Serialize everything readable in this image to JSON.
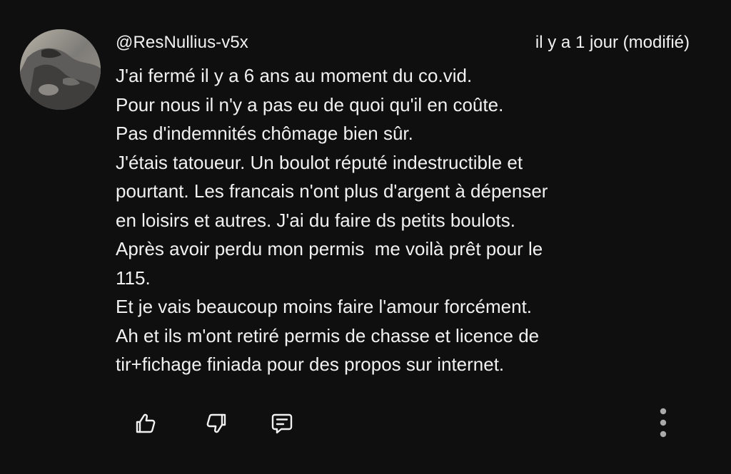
{
  "comment": {
    "author": "@ResNullius-v5x",
    "timestamp": "il y a 1 jour (modifié)",
    "lines": [
      "J'ai fermé il y a 6 ans au moment du co.vid.",
      "Pour nous il n'y a pas eu de quoi qu'il en coûte.",
      "Pas d'indemnités chômage bien sûr.",
      "J'étais tatoueur. Un boulot réputé indestructible et",
      "pourtant. Les francais n'ont plus d'argent à dépenser",
      "en loisirs et autres. J'ai du faire ds petits boulots.",
      "Après avoir perdu mon permis  me voilà prêt pour le",
      "115.",
      "Et je vais beaucoup moins faire l'amour forcément.",
      "Ah et ils m'ont retiré permis de chasse et licence de",
      "tir+fichage finiada pour des propos sur internet."
    ]
  },
  "actions": {
    "like_icon": "thumb-up-icon",
    "dislike_icon": "thumb-down-icon",
    "reply_icon": "comment-reply-icon",
    "more_icon": "more-vertical-icon"
  },
  "colors": {
    "background": "#0f0f0f",
    "text": "#f1f1f1",
    "icon": "#f1f1f1",
    "more_icon": "#aaaaaa"
  }
}
